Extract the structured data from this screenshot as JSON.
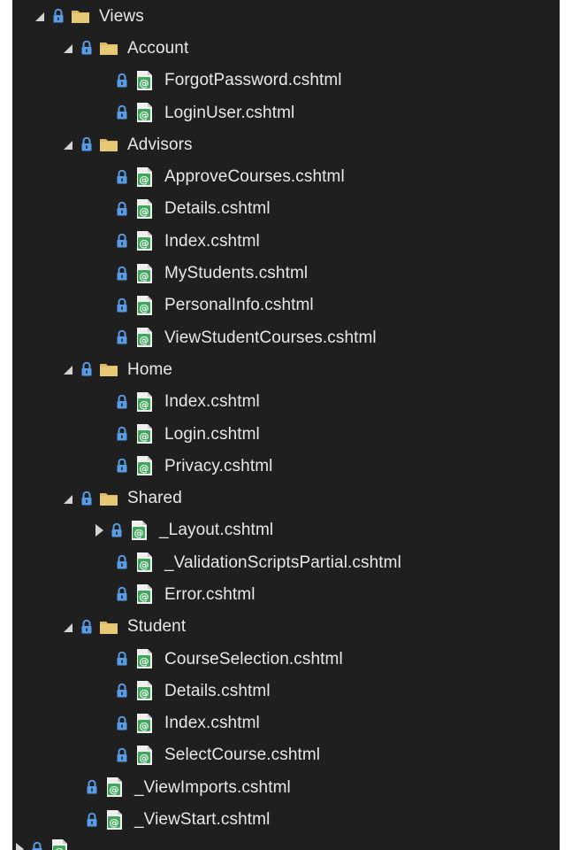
{
  "tree": [
    {
      "type": "folder",
      "label": "Views",
      "level": 0,
      "expanded": true
    },
    {
      "type": "folder",
      "label": "Account",
      "level": 1,
      "expanded": true
    },
    {
      "type": "file",
      "label": "ForgotPassword.cshtml",
      "level": 2
    },
    {
      "type": "file",
      "label": "LoginUser.cshtml",
      "level": 2
    },
    {
      "type": "folder",
      "label": "Advisors",
      "level": 1,
      "expanded": true
    },
    {
      "type": "file",
      "label": "ApproveCourses.cshtml",
      "level": 2
    },
    {
      "type": "file",
      "label": "Details.cshtml",
      "level": 2
    },
    {
      "type": "file",
      "label": "Index.cshtml",
      "level": 2
    },
    {
      "type": "file",
      "label": "MyStudents.cshtml",
      "level": 2
    },
    {
      "type": "file",
      "label": "PersonalInfo.cshtml",
      "level": 2
    },
    {
      "type": "file",
      "label": "ViewStudentCourses.cshtml",
      "level": 2
    },
    {
      "type": "folder",
      "label": "Home",
      "level": 1,
      "expanded": true
    },
    {
      "type": "file",
      "label": "Index.cshtml",
      "level": 2
    },
    {
      "type": "file",
      "label": "Login.cshtml",
      "level": 2
    },
    {
      "type": "file",
      "label": "Privacy.cshtml",
      "level": 2
    },
    {
      "type": "folder",
      "label": "Shared",
      "level": 1,
      "expanded": true
    },
    {
      "type": "file",
      "label": "_Layout.cshtml",
      "level": 2,
      "expandable": true
    },
    {
      "type": "file",
      "label": "_ValidationScriptsPartial.cshtml",
      "level": 2
    },
    {
      "type": "file",
      "label": "Error.cshtml",
      "level": 2
    },
    {
      "type": "folder",
      "label": "Student",
      "level": 1,
      "expanded": true
    },
    {
      "type": "file",
      "label": "CourseSelection.cshtml",
      "level": 2
    },
    {
      "type": "file",
      "label": "Details.cshtml",
      "level": 2
    },
    {
      "type": "file",
      "label": "Index.cshtml",
      "level": 2
    },
    {
      "type": "file",
      "label": "SelectCourse.cshtml",
      "level": 2
    },
    {
      "type": "file",
      "label": "_ViewImports.cshtml",
      "level": 1
    },
    {
      "type": "file",
      "label": "_ViewStart.cshtml",
      "level": 1
    },
    {
      "type": "file",
      "label": "",
      "level": 0,
      "expandable": true,
      "partial": true
    }
  ],
  "colors": {
    "background": "#1f1f1f",
    "text": "#e8e8e8",
    "lock": "#5a9be6",
    "folder": "#dcb862",
    "file_green": "#3fa85a"
  },
  "icons": {
    "folder": "folder-icon",
    "file": "razor-file-icon",
    "lock": "lock-icon",
    "expanded": "expanded-arrow-icon",
    "collapsed": "collapsed-arrow-icon"
  }
}
